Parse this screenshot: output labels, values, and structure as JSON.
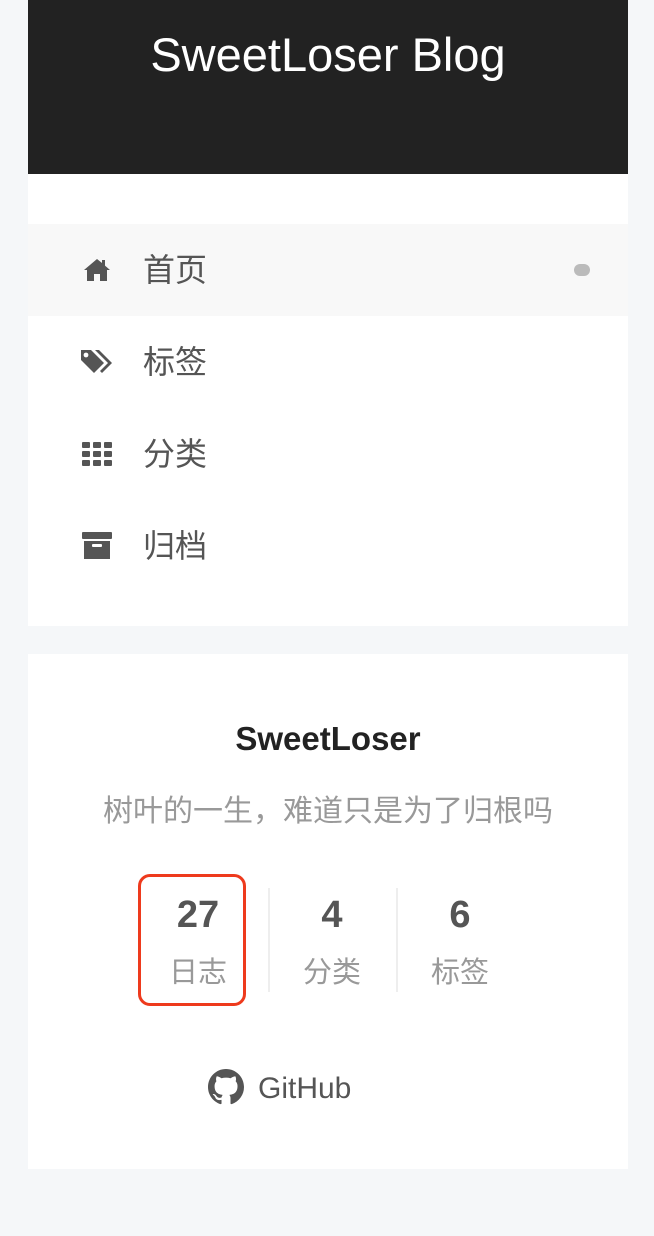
{
  "site": {
    "title": "SweetLoser Blog"
  },
  "menu": {
    "items": [
      {
        "label": "首页",
        "icon": "home-icon",
        "active": true
      },
      {
        "label": "标签",
        "icon": "tags-icon",
        "active": false
      },
      {
        "label": "分类",
        "icon": "grid-icon",
        "active": false
      },
      {
        "label": "归档",
        "icon": "archive-icon",
        "active": false
      }
    ]
  },
  "author": {
    "name": "SweetLoser",
    "description": "树叶的一生，难道只是为了归根吗"
  },
  "stats": [
    {
      "count": "27",
      "label": "日志"
    },
    {
      "count": "4",
      "label": "分类"
    },
    {
      "count": "6",
      "label": "标签"
    }
  ],
  "social": {
    "github_label": "GitHub",
    "icon": "github-icon"
  },
  "colors": {
    "header_bg": "#222222",
    "highlight": "#ee3a1d",
    "text": "#555555",
    "muted": "#999999"
  }
}
